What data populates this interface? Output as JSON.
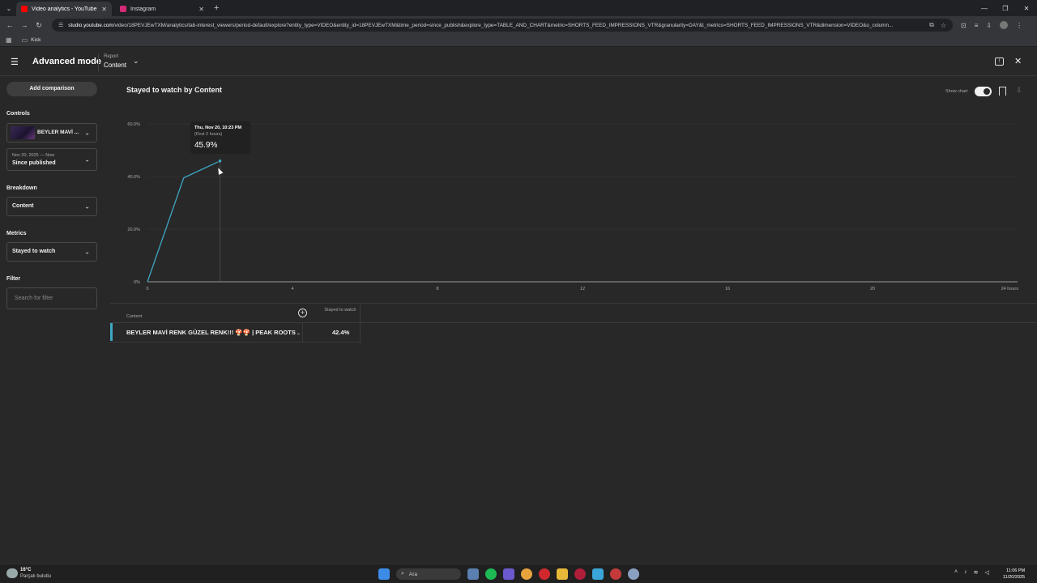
{
  "browser": {
    "tabs": [
      {
        "title": "Video analytics - YouTube Studi",
        "favicon_color": "#ff0000",
        "active": true
      },
      {
        "title": "Instagram",
        "favicon_color": "#d62976",
        "active": false
      }
    ],
    "url_host": "studio.youtube.com",
    "url_path": "/video/18PEVJEwTXM/analytics/tab-interest_viewers/period-default/explore?entity_type=VIDEO&entity_id=18PEVJEwTXM&time_period=since_publish&explore_type=TABLE_AND_CHART&metric=SHORTS_FEED_IMPRESSIONS_VTR&granularity=DAY&t_metrics=SHORTS_FEED_IMPRESSIONS_VTR&dimension=VIDEO&o_column...",
    "bookmark": "Kick"
  },
  "header": {
    "title": "Advanced mode",
    "report_label": "Report",
    "report_value": "Content"
  },
  "sidebar": {
    "add_comparison": "Add comparison",
    "controls_label": "Controls",
    "video_name": "BEYLER MAVİ ...",
    "date_range_sub": "Nov 20, 2025 — Now",
    "date_range_val": "Since published",
    "breakdown_label": "Breakdown",
    "breakdown_val": "Content",
    "metrics_label": "Metrics",
    "metrics_val": "Stayed to watch",
    "filter_label": "Filter",
    "filter_placeholder": "Search for filter"
  },
  "main": {
    "chart_title": "Stayed to watch by Content",
    "show_chart": "Show chart",
    "tooltip": {
      "date": "Thu, Nov 20, 10:23 PM",
      "sub": "(First 2 hours)",
      "value": "45.9%"
    },
    "table": {
      "col_content": "Content",
      "col_metric": "Stayed to watch",
      "row_title": "BEYLER MAVİ RENK GÜZEL RENK!!! 🍄🍄 | PEAK ROOTS ...",
      "row_value": "42.4%"
    }
  },
  "chart_data": {
    "type": "line",
    "title": "Stayed to watch by Content",
    "x_tick_labels": [
      "0",
      "4",
      "8",
      "12",
      "16",
      "20",
      "24 hours"
    ],
    "y_tick_labels": [
      "0%",
      "20.0%",
      "40.0%",
      "60.0%"
    ],
    "xlim": [
      0,
      24
    ],
    "ylim": [
      0,
      60
    ],
    "grid": true,
    "series": [
      {
        "color": "#3ea6c4",
        "x": [
          0,
          1,
          2
        ],
        "y": [
          0,
          39.5,
          45.9
        ]
      }
    ],
    "hover_x": 2
  },
  "taskbar": {
    "temp": "16°C",
    "weather": "Parçalı bulutlu",
    "search": "Ara",
    "time": "11:06 PM",
    "date": "11/20/2025"
  }
}
